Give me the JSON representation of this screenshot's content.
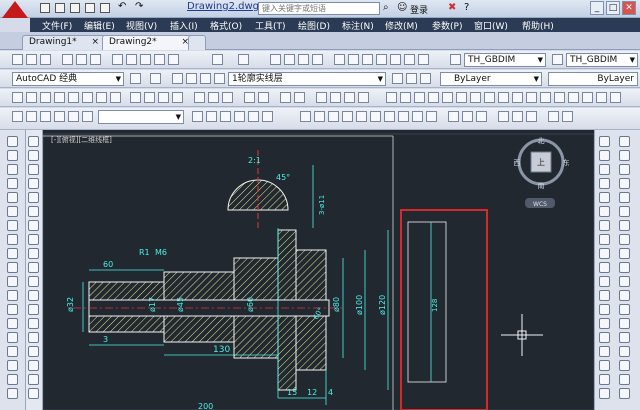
{
  "title_bar": {
    "document_title": "Drawing2.dwg",
    "search_placeholder": "键入关键字或短语",
    "login_label": "登录",
    "minimize": "_",
    "maximize": "□",
    "close": "✕"
  },
  "menu": {
    "items": [
      "文件(F)",
      "编辑(E)",
      "视图(V)",
      "插入(I)",
      "格式(O)",
      "工具(T)",
      "绘图(D)",
      "标注(N)",
      "修改(M)",
      "参数(P)",
      "窗口(W)",
      "帮助(H)"
    ]
  },
  "tabs": [
    {
      "label": "Drawing1*"
    },
    {
      "label": "Drawing2*"
    }
  ],
  "toolbars": {
    "text_style": "TH_GBDIM",
    "dim_style": "TH_GBDIM",
    "workspace": "AutoCAD 经典",
    "layer": "1轮廓实线层",
    "color": "ByLayer",
    "linetype": "ByLayer"
  },
  "viewport": {
    "label": "[-][俯视][二维线框]",
    "viewcube": {
      "north": "北",
      "south": "南",
      "west": "西",
      "east": "东",
      "top": "上"
    },
    "wcs_label": "WCS"
  },
  "drawing": {
    "dims": {
      "d60": "60",
      "r1": "R1",
      "m6": "M6",
      "d32": "ø32",
      "d17": "ø17",
      "d45": "ø45",
      "d60b": "ø60",
      "d80": "ø80",
      "d100": "ø100",
      "d120": "ø120",
      "d3": "3",
      "d130": "130",
      "d15": "15",
      "d12": "12",
      "d4": "4",
      "d200": "200",
      "a60": "60°",
      "a45": "45°",
      "ratio": "2:1",
      "note": "3-ø11",
      "len128": "128"
    }
  },
  "colors": {
    "canvas_bg": "#212830",
    "dimension": "#4cf0e6",
    "outline": "#f2f2f2",
    "hatch": "#e8e89a",
    "highlight_box": "#d52a2a",
    "menu_bg": "#2b3a55"
  }
}
